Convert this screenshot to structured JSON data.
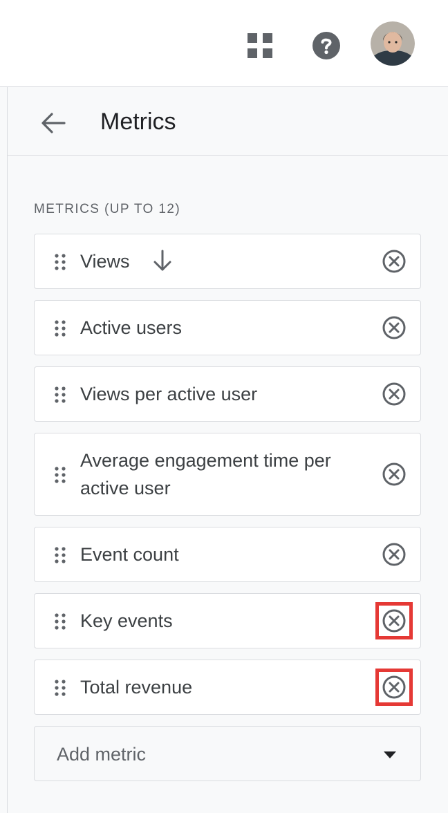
{
  "topbar": {
    "apps_icon": "apps-grid-icon",
    "help_icon": "help-circle-icon",
    "avatar_icon": "user-avatar"
  },
  "panel": {
    "back_icon": "arrow-back-icon",
    "title": "Metrics",
    "section_label": "METRICS (UP TO 12)",
    "metrics": [
      {
        "label": "Views",
        "sort_icon": "arrow-downward-icon"
      },
      {
        "label": "Active users"
      },
      {
        "label": "Views per active user"
      },
      {
        "label": "Average engagement time per active user"
      },
      {
        "label": "Event count"
      },
      {
        "label": "Key events",
        "highlighted": true
      },
      {
        "label": "Total revenue",
        "highlighted": true
      }
    ],
    "add_metric_placeholder": "Add metric"
  },
  "colors": {
    "text_primary": "#202124",
    "text_secondary": "#5f6368",
    "border": "#dadce0",
    "highlight": "#e53935",
    "icon": "#5f6368"
  }
}
